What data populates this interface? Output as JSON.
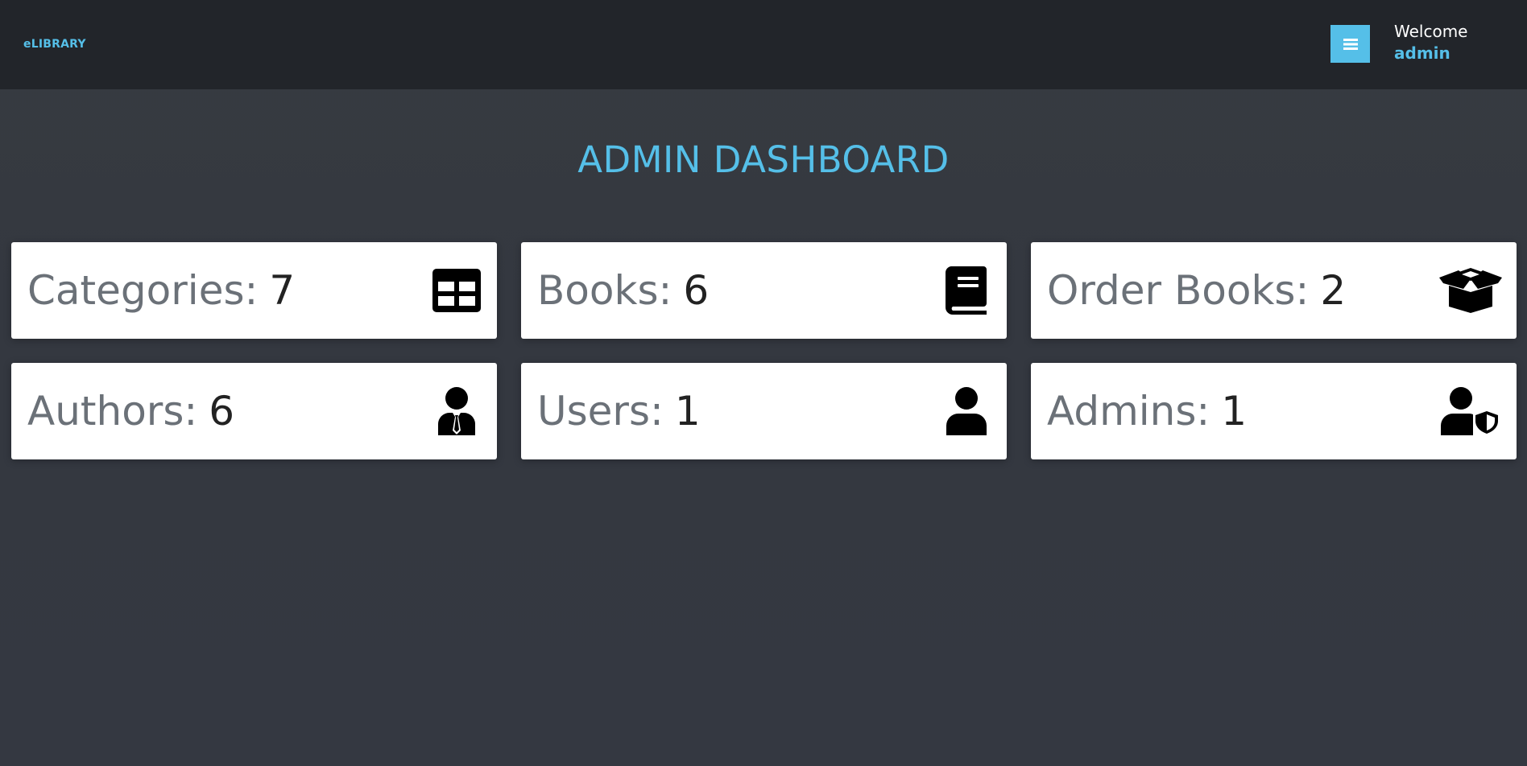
{
  "navbar": {
    "brand": "eLIBRARY",
    "menu_icon": "hamburger-icon",
    "welcome_label": "Welcome",
    "username": "admin"
  },
  "page": {
    "title": "ADMIN DASHBOARD"
  },
  "cards": [
    {
      "label": "Categories:",
      "count": "7",
      "icon": "table-grid-icon"
    },
    {
      "label": "Books:",
      "count": "6",
      "icon": "book-icon"
    },
    {
      "label": "Order Books:",
      "count": "2",
      "icon": "open-box-icon"
    },
    {
      "label": "Authors:",
      "count": "6",
      "icon": "user-tie-icon"
    },
    {
      "label": "Users:",
      "count": "1",
      "icon": "user-icon"
    },
    {
      "label": "Admins:",
      "count": "1",
      "icon": "user-shield-icon"
    }
  ],
  "colors": {
    "accent": "#55bfe8",
    "navbar_bg": "#22252a",
    "page_bg": "#353940",
    "card_bg": "#ffffff",
    "label_text": "#6b7178",
    "count_text": "#222222"
  }
}
